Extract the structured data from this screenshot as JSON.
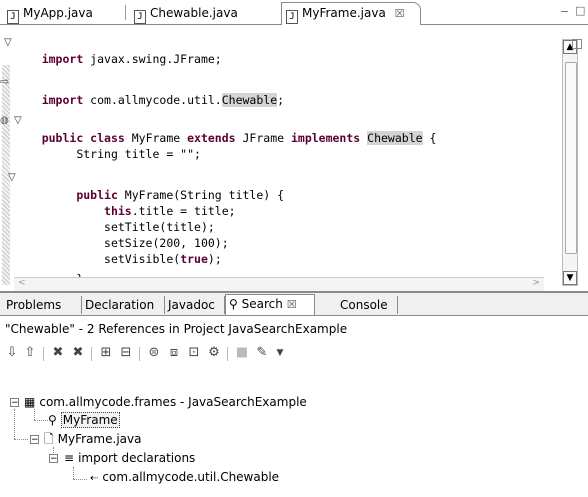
{
  "editor_tabs": [
    {
      "label": "MyApp.java",
      "icon": "java-file-icon"
    },
    {
      "label": "Chewable.java",
      "icon": "java-file-icon"
    },
    {
      "label": "MyFrame.java",
      "icon": "java-file-icon",
      "active": true,
      "close": "☒"
    }
  ],
  "window_controls": {
    "minimize": "−",
    "maximize": "□"
  },
  "code": [
    {
      "pre": "",
      "kw": "import",
      "mid": " javax.swing.JFrame;",
      "hl": "",
      "post": ""
    },
    {
      "pre": "",
      "kw": "import",
      "mid": " com.allmycode.util.",
      "hl": "Chewable",
      "post": ";"
    },
    {
      "pre": "",
      "kw": "public class",
      "mid": " MyFrame ",
      "kw2": "extends",
      "mid2": " JFrame ",
      "kw3": "implements",
      "mid3": " ",
      "hl": "Chewable",
      "post": " {"
    },
    {
      "pre": "     String title = \"\";"
    },
    {
      "pre": "     ",
      "kw": "public",
      "mid": " MyFrame(String title) {"
    },
    {
      "pre": "         ",
      "kw": "this",
      "mid": ".title = title;"
    },
    {
      "pre": "         setTitle(title);"
    },
    {
      "pre": "         setSize(200, 100);"
    },
    {
      "pre": "         setVisible(",
      "kw": "true",
      "mid": ");"
    },
    {
      "pre": "     }"
    }
  ],
  "view_tabs": [
    {
      "label": "Problems"
    },
    {
      "label": "Declaration"
    },
    {
      "label": "Javadoc"
    },
    {
      "label": "Search",
      "active": true,
      "close": "☒"
    },
    {
      "label": "Console"
    }
  ],
  "search_summary": "\"Chewable\" - 2 References in Project JavaSearchExample",
  "tree": [
    {
      "label": "com.allmycode.frames - JavaSearchExample",
      "icon": "package-icon",
      "depth": 0
    },
    {
      "label": "MyFrame",
      "icon": "class-icon",
      "depth": 1,
      "selected": true
    },
    {
      "label": "MyFrame.java",
      "icon": "java-file-icon",
      "depth": 1
    },
    {
      "label": "import declarations",
      "icon": "imports-icon",
      "depth": 2
    },
    {
      "label": "com.allmycode.util.Chewable",
      "icon": "import-icon",
      "depth": 3
    }
  ],
  "colors": {
    "keyword": "#5a0033",
    "highlight": "#d4d4d4",
    "border": "#8a8a8a"
  }
}
